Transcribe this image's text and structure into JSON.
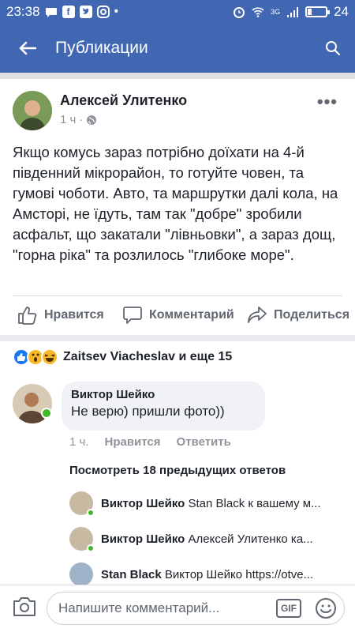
{
  "status_bar": {
    "time": "23:38",
    "battery": "24",
    "battery_level": 0.24,
    "signal_label": "3G"
  },
  "app_bar": {
    "title": "Публикации"
  },
  "post": {
    "author": "Алексей Улитенко",
    "time": "1 ч",
    "more": "•••",
    "text": "Якщо комусь зараз потрібно доїхати на 4-й південний мікрорайон, то готуйте човен, та гумові чоботи. Авто, та маршрутки далі кола, на Амсторі, не їдуть, там так \"добре\" зробили асфальт, що закатали \"лівньовки\", а зараз дощ,  \"горна ріка\" та розлилось \"глибоке море\"."
  },
  "actions": {
    "like": "Нравится",
    "comment": "Комментарий",
    "share": "Поделиться"
  },
  "reactions": {
    "summary": "Zaitsev Viacheslav и еще 15"
  },
  "comment": {
    "author": "Виктор Шейко",
    "text": "Не верю) пришли фото))",
    "time": "1 ч.",
    "like": "Нравится",
    "reply": "Ответить"
  },
  "previous_replies": "Посмотреть 18 предыдущих ответов",
  "replies": [
    {
      "author": "Виктор Шейко",
      "text": "Stan Black к вашему м..."
    },
    {
      "author": "Виктор Шейко",
      "text": "Алексей Улитенко ка..."
    },
    {
      "author": "Stan Black",
      "text": "Виктор Шейко https://otve..."
    }
  ],
  "composer": {
    "placeholder": "Напишите комментарий...",
    "gif_label": "GIF"
  },
  "colors": {
    "brand": "#4267b2",
    "online": "#42b72a",
    "muted": "#606770"
  }
}
